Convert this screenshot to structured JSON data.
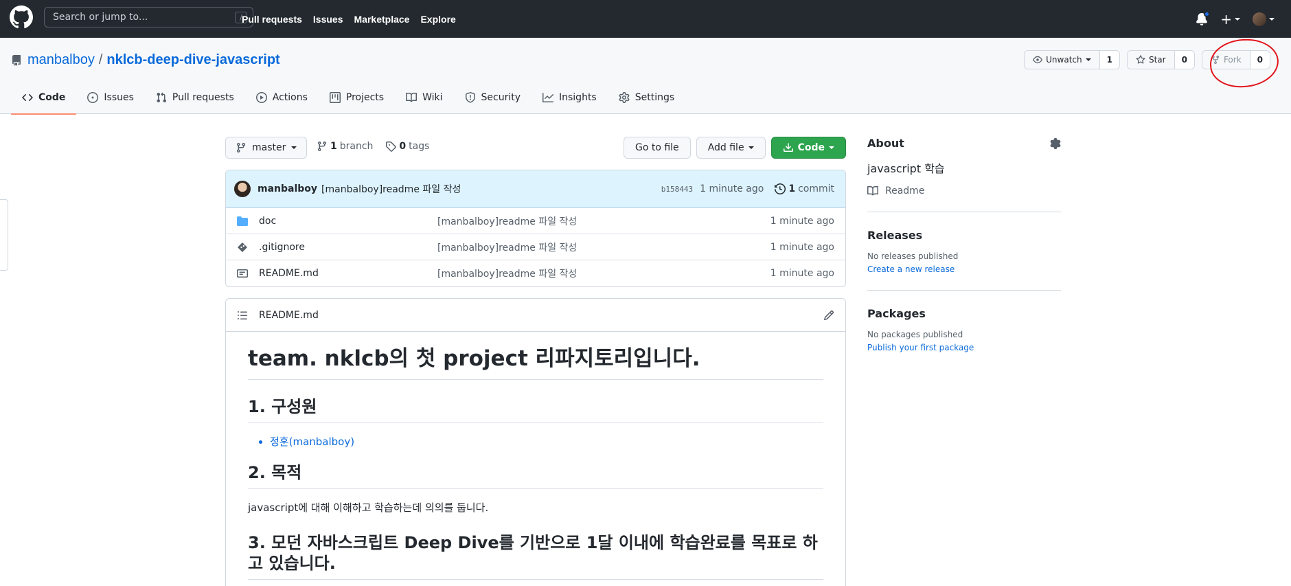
{
  "header": {
    "search_placeholder": "Search or jump to...",
    "search_shortcut": "/",
    "nav": [
      "Pull requests",
      "Issues",
      "Marketplace",
      "Explore"
    ],
    "new_symbol": "+"
  },
  "repo": {
    "owner": "manbalboy",
    "separator": "/",
    "name": "nklcb-deep-dive-javascript",
    "watch_label": "Unwatch",
    "watch_count": "1",
    "star_label": "Star",
    "star_count": "0",
    "fork_label": "Fork",
    "fork_count": "0",
    "annotation_color": "#e4141b"
  },
  "tabs": [
    {
      "label": "Code",
      "icon": "code-icon",
      "selected": true
    },
    {
      "label": "Issues",
      "icon": "issue-icon"
    },
    {
      "label": "Pull requests",
      "icon": "pull-request-icon"
    },
    {
      "label": "Actions",
      "icon": "play-icon"
    },
    {
      "label": "Projects",
      "icon": "project-icon"
    },
    {
      "label": "Wiki",
      "icon": "book-icon"
    },
    {
      "label": "Security",
      "icon": "shield-icon"
    },
    {
      "label": "Insights",
      "icon": "graph-icon"
    },
    {
      "label": "Settings",
      "icon": "gear-icon"
    }
  ],
  "file_nav": {
    "branch": "master",
    "branch_count": "1",
    "branch_word": "branch",
    "tag_count": "0",
    "tag_word": "tags",
    "go_to_file": "Go to file",
    "add_file": "Add file",
    "code": "Code"
  },
  "commit": {
    "author": "manbalboy",
    "message": "[manbalboy]readme 파일 작성",
    "sha": "b158443",
    "age": "1 minute ago",
    "count": "1",
    "count_word": "commit"
  },
  "files": [
    {
      "name": "doc",
      "type": "folder",
      "message": "[manbalboy]readme 파일 작성",
      "age": "1 minute ago"
    },
    {
      "name": ".gitignore",
      "type": "gitfile",
      "message": "[manbalboy]readme 파일 작성",
      "age": "1 minute ago"
    },
    {
      "name": "README.md",
      "type": "file",
      "message": "[manbalboy]readme 파일 작성",
      "age": "1 minute ago"
    }
  ],
  "readme": {
    "filename": "README.md",
    "h1": "team. nklcb의 첫 project 리파지토리입니다.",
    "h2_members": "1. 구성원",
    "member_link": "정훈(manbalboy)",
    "h2_goal": "2. 목적",
    "goal_text": "javascript에 대해 이해하고 학습하는데 의의를 둡니다.",
    "h2_plan": "3. 모던 자바스크립트 Deep Dive를 기반으로 1달 이내에 학습완료를 목표로 하고 있습니다."
  },
  "sidebar": {
    "about_title": "About",
    "about_desc": "javascript 학습",
    "readme_link": "Readme",
    "releases_title": "Releases",
    "releases_none": "No releases published",
    "releases_create": "Create a new release",
    "packages_title": "Packages",
    "packages_none": "No packages published",
    "packages_publish": "Publish your first package"
  }
}
